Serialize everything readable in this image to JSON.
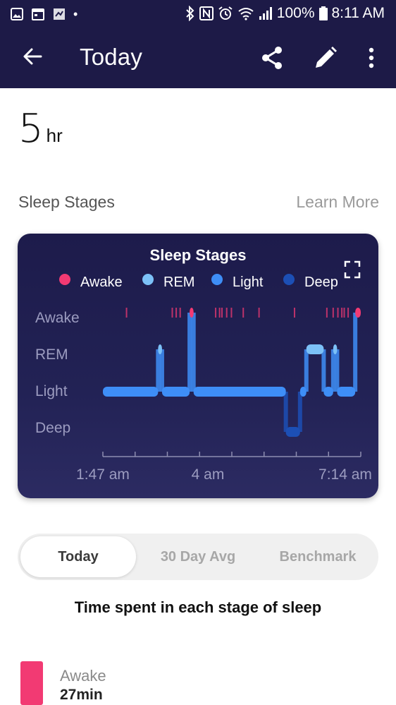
{
  "status_bar": {
    "battery": "100%",
    "time": "8:11 AM"
  },
  "app_bar": {
    "title": "Today",
    "icons": [
      "back-arrow-icon",
      "share-icon",
      "edit-pencil-icon",
      "more-vert-icon"
    ]
  },
  "summary": {
    "duration_value": "5",
    "duration_unit": "hr"
  },
  "section": {
    "label": "Sleep Stages",
    "link": "Learn More"
  },
  "chart_data": {
    "type": "line",
    "title": "Sleep Stages",
    "legend": [
      {
        "name": "Awake",
        "color": "#f23a73"
      },
      {
        "name": "REM",
        "color": "#7cc1f7"
      },
      {
        "name": "Light",
        "color": "#3e8ef7"
      },
      {
        "name": "Deep",
        "color": "#1c4fb5"
      }
    ],
    "y_levels": [
      "Awake",
      "REM",
      "Light",
      "Deep"
    ],
    "x_tick_labels": [
      "1:47 am",
      "4 am",
      "7:14 am"
    ],
    "x_range_minutes": [
      0,
      327
    ],
    "stages": [
      {
        "stage": "Light",
        "start": 0,
        "end": 70
      },
      {
        "stage": "REM",
        "start": 70,
        "end": 75
      },
      {
        "stage": "Light",
        "start": 75,
        "end": 110
      },
      {
        "stage": "Awake",
        "start": 110,
        "end": 115
      },
      {
        "stage": "Light",
        "start": 115,
        "end": 232
      },
      {
        "stage": "Deep",
        "start": 232,
        "end": 250
      },
      {
        "stage": "Light",
        "start": 250,
        "end": 258
      },
      {
        "stage": "REM",
        "start": 258,
        "end": 280
      },
      {
        "stage": "Light",
        "start": 280,
        "end": 292
      },
      {
        "stage": "REM",
        "start": 292,
        "end": 297
      },
      {
        "stage": "Light",
        "start": 297,
        "end": 320
      },
      {
        "stage": "Awake",
        "start": 320,
        "end": 327
      }
    ],
    "awake_ticks": [
      30,
      88,
      93,
      98,
      143,
      148,
      151,
      157,
      163,
      178,
      198,
      243,
      284,
      292,
      298,
      303,
      306,
      311
    ]
  },
  "fullscreen_icon": "fullscreen-icon",
  "tabs": [
    {
      "label": "Today",
      "active": true
    },
    {
      "label": "30 Day Avg",
      "active": false
    },
    {
      "label": "Benchmark",
      "active": false
    }
  ],
  "caption": "Time spent in each stage of sleep",
  "stage_rows": [
    {
      "name": "Awake",
      "duration": "27min",
      "color": "#f23a73"
    }
  ]
}
